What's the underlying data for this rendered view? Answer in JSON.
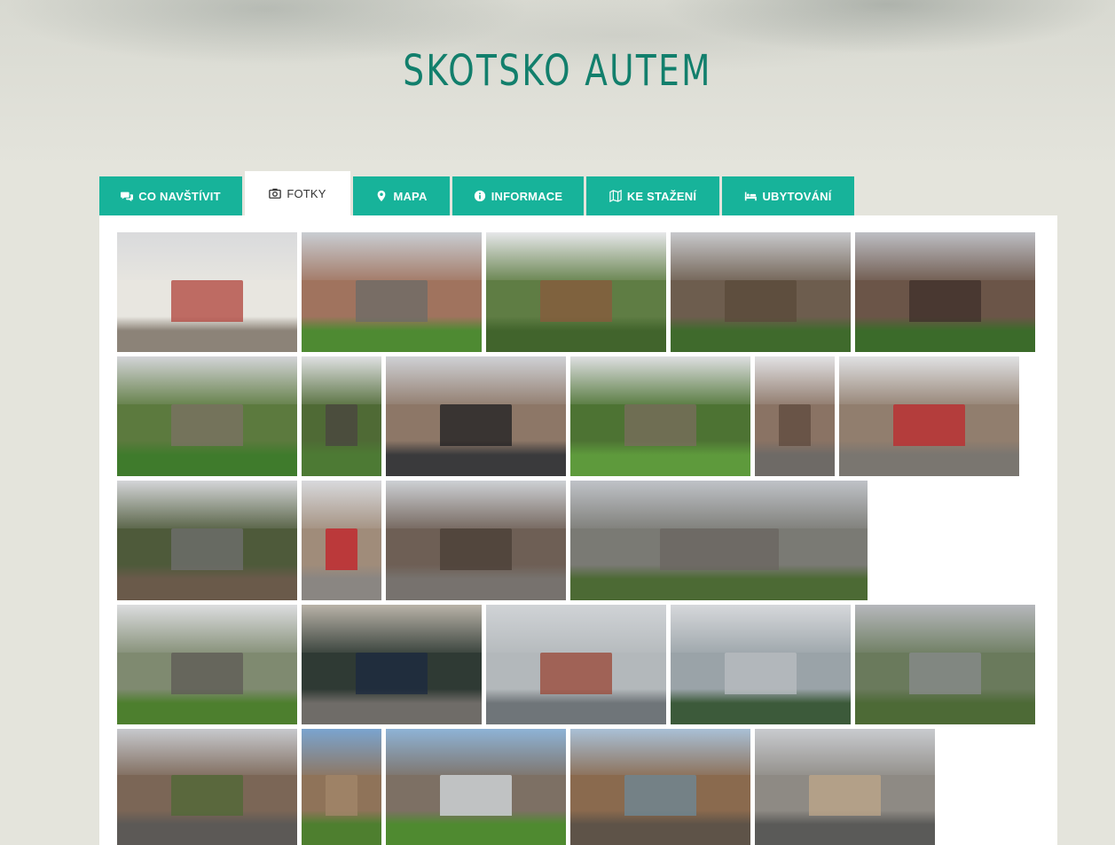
{
  "header": {
    "title": "SKOTSKO AUTEM"
  },
  "tabs": [
    {
      "label": "CO NAVŠTÍVIT",
      "icon": "comments-icon",
      "active": false
    },
    {
      "label": "FOTKY",
      "icon": "camera-icon",
      "active": true
    },
    {
      "label": "MAPA",
      "icon": "map-marker-icon",
      "active": false
    },
    {
      "label": "INFORMACE",
      "icon": "info-circle-icon",
      "active": false
    },
    {
      "label": "KE STAŽENÍ",
      "icon": "map-icon",
      "active": false
    },
    {
      "label": "UBYTOVÁNÍ",
      "icon": "bed-icon",
      "active": false
    }
  ],
  "colors": {
    "accent": "#17b39a",
    "title": "#127f6c",
    "background": "#e4e4dc"
  },
  "gallery": {
    "photos": [
      {
        "id": "village-street",
        "sky": "#d9dadc",
        "mid": "#e8e6e0",
        "ground": "#8c8378",
        "detail": "#b0413a"
      },
      {
        "id": "abbey-ruins",
        "sky": "#c9cdd2",
        "mid": "#a0735e",
        "ground": "#4e8a32",
        "detail": "#6b6b68"
      },
      {
        "id": "fountain-castle",
        "sky": "#e6e7e9",
        "mid": "#5f7d44",
        "ground": "#41642c",
        "detail": "#8a5a3c"
      },
      {
        "id": "castle-rock",
        "sky": "#c8c9cc",
        "mid": "#6d5d4e",
        "ground": "#3f6a2c",
        "detail": "#5a4a3a"
      },
      {
        "id": "old-town-skyline",
        "sky": "#bdbec3",
        "mid": "#6b5548",
        "ground": "#3b6b2a",
        "detail": "#3d2f2a"
      },
      {
        "id": "princes-gardens",
        "sky": "#d3d4d7",
        "mid": "#5c7a3e",
        "ground": "#3f7b2c",
        "detail": "#7c7266"
      },
      {
        "id": "scott-monument",
        "sky": "#dfe0e2",
        "mid": "#4f6a35",
        "ground": "#4d7a34",
        "detail": "#4a4440"
      },
      {
        "id": "waverley-taxis",
        "sky": "#cfd1d5",
        "mid": "#8d7767",
        "ground": "#3a3a3c",
        "detail": "#1e1e20"
      },
      {
        "id": "gardens-castle-view",
        "sky": "#dedfe1",
        "mid": "#4d7333",
        "ground": "#5e9a3c",
        "detail": "#7b6c5f"
      },
      {
        "id": "royal-mile-narrow",
        "sky": "#e2e2e4",
        "mid": "#8a7364",
        "ground": "#6e6a66",
        "detail": "#5d4a3e"
      },
      {
        "id": "royal-mile-phonebox",
        "sky": "#e0e1e3",
        "mid": "#917e6e",
        "ground": "#7a7670",
        "detail": "#c0282c"
      },
      {
        "id": "calton-hill-cliff",
        "sky": "#d4d5d8",
        "mid": "#4e5a3a",
        "ground": "#6a5a4a",
        "detail": "#707070"
      },
      {
        "id": "red-phoneboxes",
        "sky": "#d8d9dc",
        "mid": "#a08c7a",
        "ground": "#8a8682",
        "detail": "#c41e26"
      },
      {
        "id": "st-giles-cathedral",
        "sky": "#cdd0d4",
        "mid": "#6e5f55",
        "ground": "#77726e",
        "detail": "#4a3e36"
      },
      {
        "id": "dugald-stewart-view",
        "sky": "#bfc2c7",
        "mid": "#7a7a74",
        "ground": "#4c6a34",
        "detail": "#6b6660"
      },
      {
        "id": "national-monument",
        "sky": "#dcdddf",
        "mid": "#7f8a70",
        "ground": "#4d7f2e",
        "detail": "#5e5a55"
      },
      {
        "id": "bagpiper-door",
        "sky": "#b9b3a8",
        "mid": "#2f3a34",
        "ground": "#6f6c68",
        "detail": "#1c2a40"
      },
      {
        "id": "forth-bridge",
        "sky": "#d0d3d6",
        "mid": "#b3b8bb",
        "ground": "#6f7579",
        "detail": "#9a4534"
      },
      {
        "id": "falkirk-wheel",
        "sky": "#d6d8db",
        "mid": "#9aa3a8",
        "ground": "#3c5a3a",
        "detail": "#b9bec2"
      },
      {
        "id": "stirling-valley",
        "sky": "#b6b8bc",
        "mid": "#6a7a5c",
        "ground": "#4d6a36",
        "detail": "#8a8c8e"
      },
      {
        "id": "st-andrews-buildings",
        "sky": "#c7c9cd",
        "mid": "#7b6656",
        "ground": "#5c5956",
        "detail": "#4f6a35"
      },
      {
        "id": "ruined-tower",
        "sky": "#7aa4cf",
        "mid": "#8f7359",
        "ground": "#4e7f2f",
        "detail": "#a3876b"
      },
      {
        "id": "st-andrews-cathedral",
        "sky": "#8eb3d6",
        "mid": "#7d7064",
        "ground": "#4f8a30",
        "detail": "#d7dde3"
      },
      {
        "id": "rocky-shore",
        "sky": "#a9c0d6",
        "mid": "#8a6a4e",
        "ground": "#5e5348",
        "detail": "#6c8a9a"
      },
      {
        "id": "pier-sea",
        "sky": "#c9cbcf",
        "mid": "#8e8a84",
        "ground": "#5a5a58",
        "detail": "#bfa78a"
      }
    ]
  }
}
